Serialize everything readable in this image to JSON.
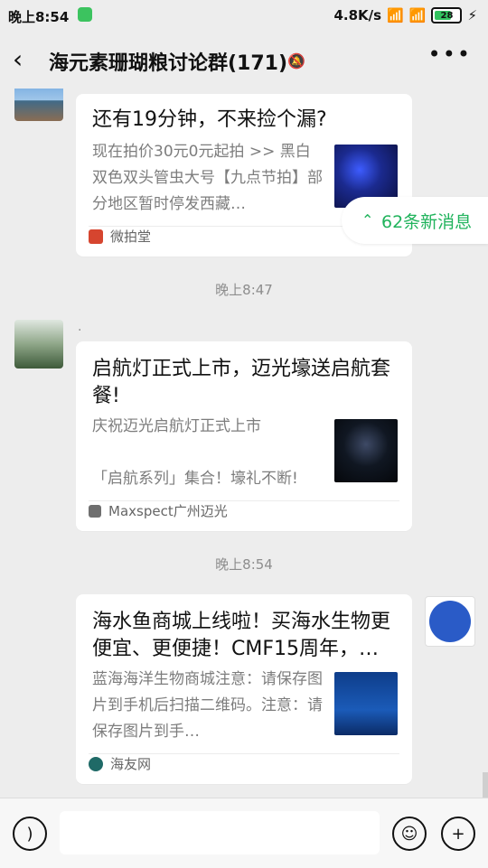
{
  "status_bar": {
    "time": "晚上8:54",
    "network_speed": "4.8K/s",
    "battery": "28"
  },
  "header": {
    "title": "海元素珊瑚粮讨论群(171)",
    "back_icon": "chevron-left-icon",
    "more_icon": "more-icon"
  },
  "new_messages": {
    "label": "62条新消息"
  },
  "messages": [
    {
      "title": "还有19分钟，不来捡个漏?",
      "desc": "现在拍价30元0元起拍 >> 黑白双色双头管虫大号【九点节拍】部分地区暂时停发西藏…",
      "source": "微拍堂"
    },
    {
      "time": "晚上8:47",
      "sender": ".",
      "title": "启航灯正式上市，迈光壕送启航套餐!",
      "desc": "庆祝迈光启航灯正式上市\n\n「启航系列」集合！壕礼不断!",
      "source": "Maxspect广州迈光"
    },
    {
      "time": "晚上8:54",
      "title": "海水鱼商城上线啦！买海水生物更便宜、更便捷！CMF15周年，…",
      "desc": "蓝海海洋生物商城注意：请保存图片到手机后扫描二维码。注意：请保存图片到手…",
      "source": "海友网"
    }
  ]
}
